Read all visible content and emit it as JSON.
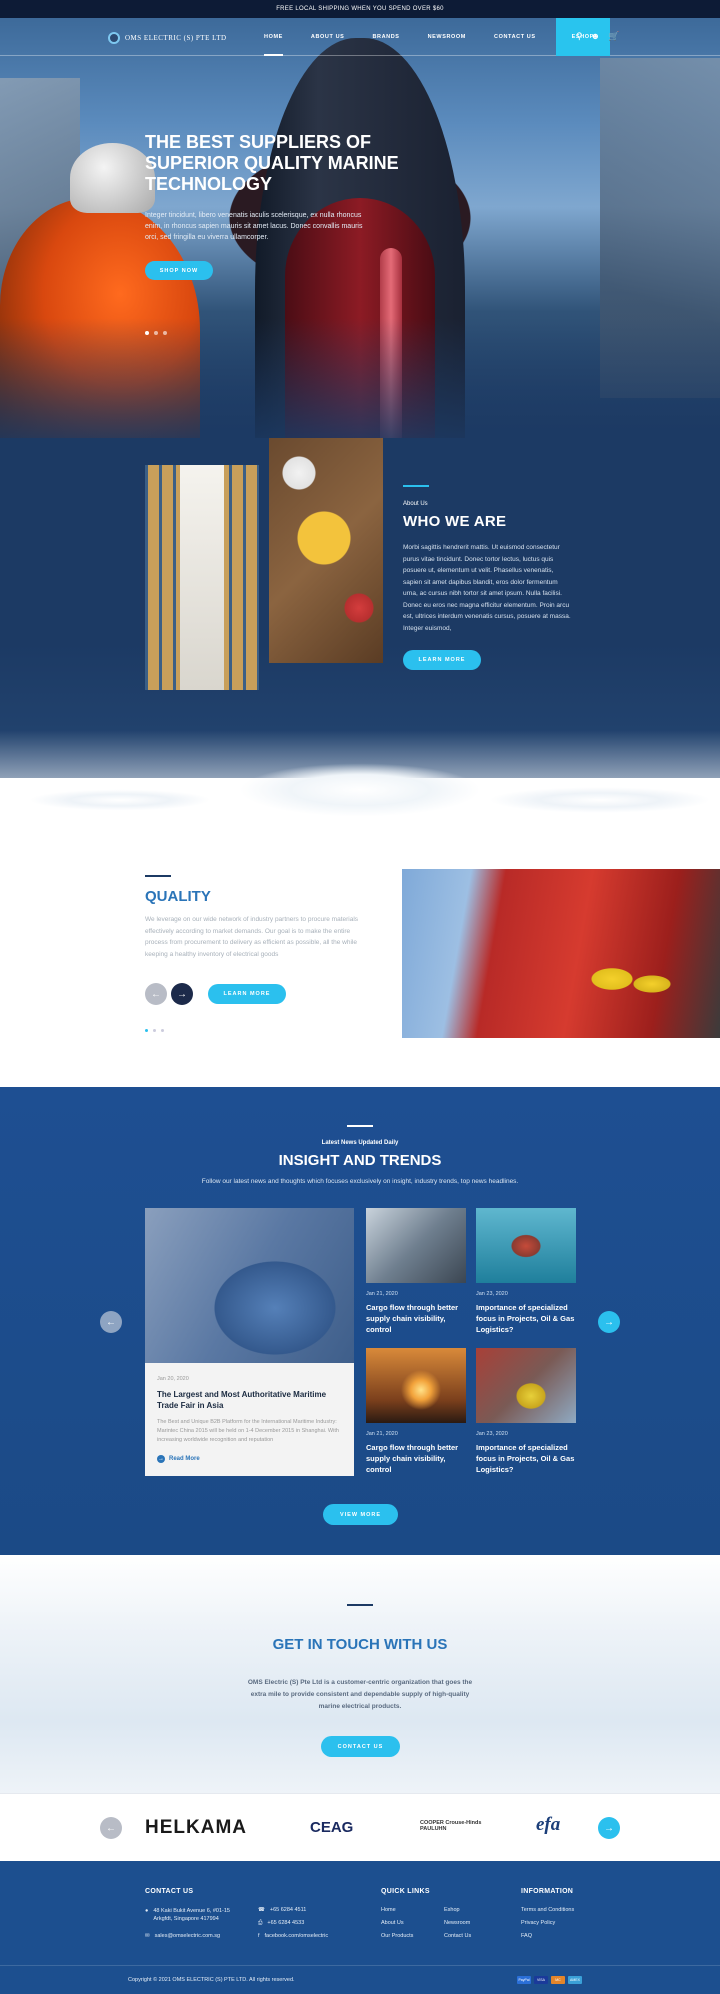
{
  "topbar": {
    "text": "FREE LOCAL SHIPPING WHEN YOU SPEND OVER $60"
  },
  "nav": {
    "logo_text": "OMS ELECTRIC (S) PTE LTD",
    "items": [
      {
        "label": "HOME"
      },
      {
        "label": "ABOUT US"
      },
      {
        "label": "BRANDS"
      },
      {
        "label": "NEWSROOM"
      },
      {
        "label": "CONTACT US"
      },
      {
        "label": "ESHOP"
      }
    ],
    "icons": [
      "search-icon",
      "user-icon",
      "cart-icon"
    ]
  },
  "hero": {
    "title": "THE BEST SUPPLIERS OF SUPERIOR QUALITY MARINE TECHNOLOGY",
    "text": "Integer tincidunt, libero venenatis iaculis scelerisque, ex nulla rhoncus enim, in rhoncus sapien mauris sit amet lacus. Donec convallis mauris orci, sed fringilla eu viverra ullamcorper.",
    "button": "SHOP NOW",
    "slides": 3,
    "active_slide": 1
  },
  "about": {
    "eyebrow": "About Us",
    "title": "WHO WE ARE",
    "text": "Morbi sagittis hendrerit mattis. Ut euismod consectetur purus vitae tincidunt. Donec tortor lectus, luctus quis posuere ut, elementum ut velit. Phasellus venenatis, sapien sit amet dapibus blandit, eros dolor fermentum urna, ac cursus nibh tortor sit amet ipsum. Nulla facilisi. Donec eu eros nec magna efficitur elementum. Proin arcu est, ultrices interdum venenatis cursus, posuere at massa. Integer euismod,",
    "button": "LEARN MORE"
  },
  "quality": {
    "title": "QUALITY",
    "text": "We leverage on our wide network of industry partners to procure materials effectively according to market demands. Our goal is to make the entire process from procurement to delivery as efficient as possible, all the while keeping a healthy inventory of electrical goods",
    "button": "LEARN MORE",
    "slides": 3,
    "active_slide": 1
  },
  "insight": {
    "eyebrow": "Latest News Updated Daily",
    "title": "INSIGHT AND TRENDS",
    "subtitle": "Follow our latest news and thoughts which focuses exclusively on insight, industry trends, top news headlines.",
    "featured": {
      "date": "Jan 20, 2020",
      "title": "The Largest and Most Authoritative Maritime Trade Fair in Asia",
      "text": "The Best and Unique B2B Platform for the International Maritime Industry: Marintec China 2015 will be held on 1-4 December 2015 in Shanghai. With increasing worldwide recognition and reputation",
      "read_more": "Read More"
    },
    "cards": [
      {
        "date": "Jan 21, 2020",
        "title": "Cargo flow through better supply chain visibility, control"
      },
      {
        "date": "Jan 23, 2020",
        "title": "Importance of specialized focus in Projects, Oil & Gas Logistics?"
      },
      {
        "date": "Jan 21, 2020",
        "title": "Cargo flow through better supply chain visibility, control"
      },
      {
        "date": "Jan 23, 2020",
        "title": "Importance of specialized focus in Projects, Oil & Gas Logistics?"
      }
    ],
    "button": "VIEW MORE"
  },
  "contact": {
    "title": "GET IN TOUCH WITH US",
    "text": "OMS Electric (S) Pte Ltd is a customer-centric organization that goes the extra mile to provide consistent and dependable supply of high-quality marine electrical products.",
    "button": "CONTACT US"
  },
  "partners": {
    "brands": [
      "HELKAMA",
      "CEAG",
      "COOPER Crouse-Hinds PAULUHN",
      "efa"
    ]
  },
  "footer": {
    "contact_title": "CONTACT US",
    "address": "48 Kaki Bukit Avenue 6, #01-15 Arkgfdt, Singapore 417994",
    "phone": "+65 6284 4511",
    "fax": "+65 6284 4533",
    "email": "sales@omselectric.com.sg",
    "facebook": "facebook.com/omselectric",
    "quick_title": "QUICK LINKS",
    "quick_links": [
      "Home",
      "About Us",
      "Our Products",
      "Eshop",
      "Newsroom",
      "Contact Us"
    ],
    "info_title": "INFORMATION",
    "info_links": [
      "Terms and Conditions",
      "Privacy Policy",
      "FAQ"
    ],
    "copyright": "Copyright © 2021 OMS ELECTRIC (S) PTE LTD. All rights reserved.",
    "payments": [
      "PayPal",
      "VISA",
      "MC",
      "AMEX"
    ]
  }
}
